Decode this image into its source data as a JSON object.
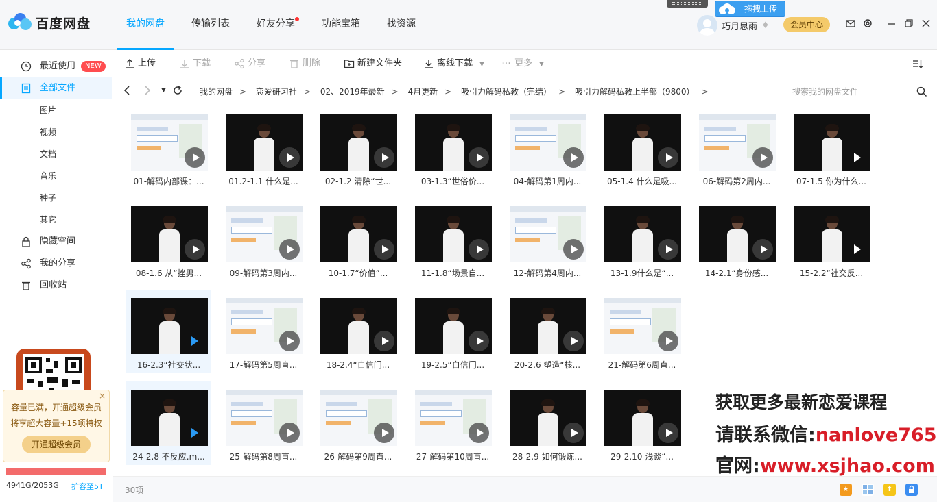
{
  "app": {
    "name": "百度网盘"
  },
  "nav": [
    {
      "label": "我的网盘",
      "active": true
    },
    {
      "label": "传输列表"
    },
    {
      "label": "好友分享",
      "dot": true
    },
    {
      "label": "功能宝箱"
    },
    {
      "label": "找资源"
    }
  ],
  "topbar": {
    "drag_upload": "拖拽上传",
    "username": "巧月思雨",
    "vip_center": "会员中心"
  },
  "sidebar": {
    "recent": "最近使用",
    "new_badge": "NEW",
    "all_files": "全部文件",
    "subs": [
      "图片",
      "视频",
      "文档",
      "音乐",
      "种子",
      "其它"
    ],
    "hidden": "隐藏空间",
    "shares": "我的分享",
    "recycle": "回收站",
    "promo_line1": "容量已满，开通超级会员",
    "promo_line2": "将享超大容量+15项特权",
    "promo_button": "开通超级会员",
    "promo_close": "×",
    "quota": "4941G/2053G",
    "expand": "扩容至5T"
  },
  "toolbar": {
    "upload": "上传",
    "download": "下载",
    "share": "分享",
    "delete": "删除",
    "new_folder": "新建文件夹",
    "offline": "离线下载",
    "more": "更多"
  },
  "breadcrumb": [
    "我的网盘",
    "恋爱研习社",
    "02、2019年最新",
    "4月更新",
    "吸引力解码私教（完结）",
    "吸引力解码私教上半部（9800）"
  ],
  "search": {
    "placeholder": "搜索我的网盘文件"
  },
  "files": [
    "01-解码内部课：...",
    "01.2-1.1 什么是...",
    "02-1.2 清除“世...",
    "03-1.3“世俗价...",
    "04-解码第1周内...",
    "05-1.4 什么是吸...",
    "06-解码第2周内...",
    "07-1.5 你为什么...",
    "08-1.6 从“挫男...",
    "09-解码第3周内...",
    "10-1.7“价值”...",
    "11-1.8“场景自...",
    "12-解码第4周内...",
    "13-1.9什么是“...",
    "14-2.1“身份感...",
    "15-2.2“社交反...",
    "16-2.3“社交状...",
    "17-解码第5周直...",
    "18-2.4“自信门...",
    "19-2.5“自信门...",
    "20-2.6 塑造“核...",
    "21-解码第6周直...",
    "",
    "",
    "24-2.8 不反应.m...",
    "25-解码第8周直...",
    "26-解码第9周直...",
    "27-解码第10周直...",
    "28-2.9 如何锻炼...",
    "29-2.10 浅谈“..."
  ],
  "watermark": {
    "line1": "获取更多最新恋爱课程",
    "line2_label": "请联系微信:",
    "line2_value": "nanlove765",
    "line3_label": "官网:",
    "line3_value": "www.xsjhao.com"
  },
  "status": {
    "count": "30项"
  }
}
